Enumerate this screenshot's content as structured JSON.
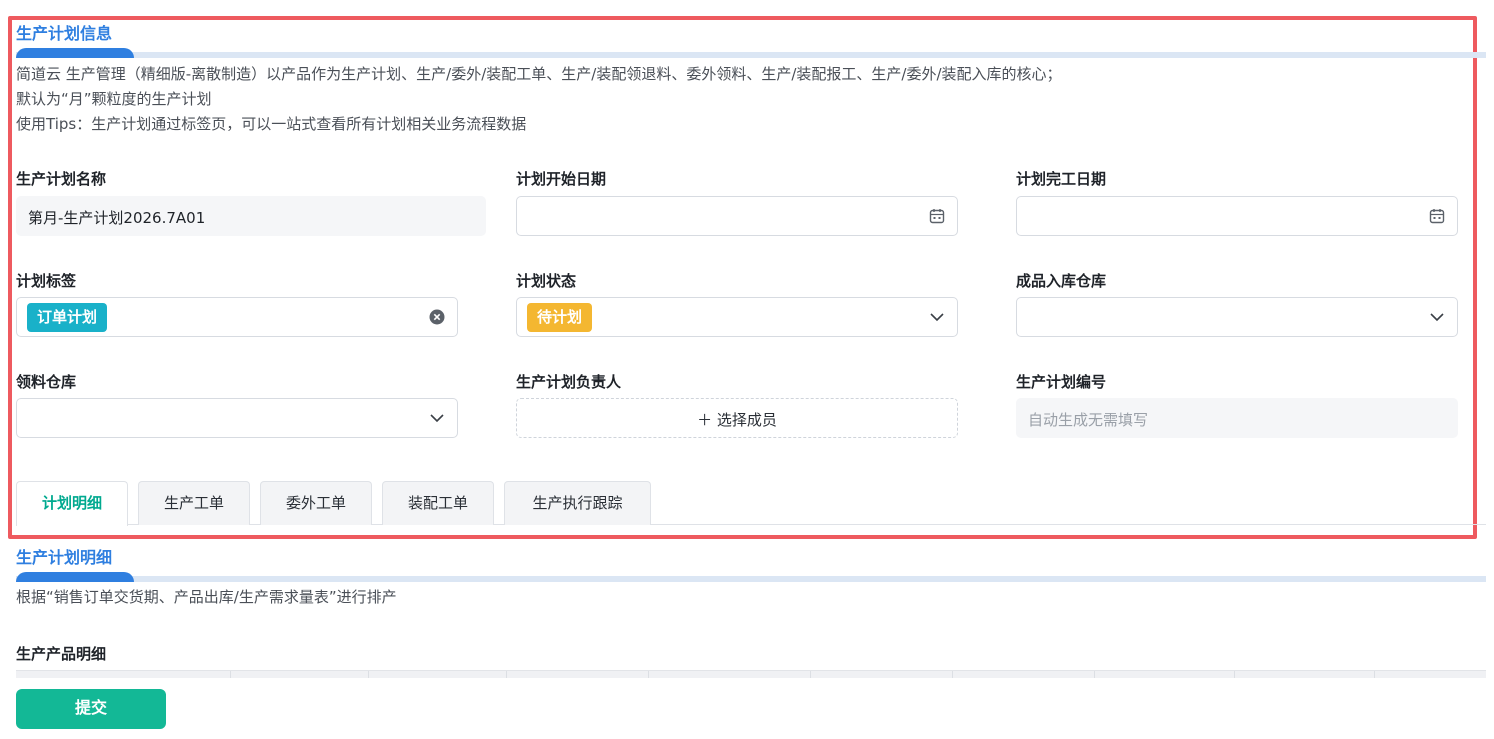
{
  "section1": {
    "title": "生产计划信息",
    "desc_lines": [
      "简道云 生产管理（精细版-离散制造）以产品作为生产计划、生产/委外/装配工单、生产/装配领退料、委外领料、生产/装配报工、生产/委外/装配入库的核心；",
      "默认为“月”颗粒度的生产计划",
      "使用Tips：生产计划通过标签页，可以一站式查看所有计划相关业务流程数据"
    ]
  },
  "fields": {
    "plan_name": {
      "label": "生产计划名称",
      "value": "第月-生产计划2026.7A01"
    },
    "start_date": {
      "label": "计划开始日期",
      "value": ""
    },
    "end_date": {
      "label": "计划完工日期",
      "value": ""
    },
    "plan_tag": {
      "label": "计划标签",
      "tag": "订单计划",
      "tag_color": "#19b1c9"
    },
    "plan_status": {
      "label": "计划状态",
      "tag": "待计划",
      "tag_color": "#f4b731"
    },
    "warehouse_in": {
      "label": "成品入库仓库",
      "value": ""
    },
    "material_warehouse": {
      "label": "领料仓库",
      "value": ""
    },
    "owner": {
      "label": "生产计划负责人",
      "button": "＋ 选择成员"
    },
    "plan_no": {
      "label": "生产计划编号",
      "placeholder": "自动生成无需填写"
    }
  },
  "tabs": [
    {
      "label": "计划明细",
      "active": true
    },
    {
      "label": "生产工单",
      "active": false
    },
    {
      "label": "委外工单",
      "active": false
    },
    {
      "label": "装配工单",
      "active": false
    },
    {
      "label": "生产执行跟踪",
      "active": false
    }
  ],
  "section2": {
    "title": "生产计划明细",
    "desc": "根据“销售订单交货期、产品出库/生产需求量表”进行排产",
    "subtable_label": "生产产品明细"
  },
  "footer": {
    "submit": "提交"
  },
  "colors": {
    "accent": "#2f7fe0",
    "primary": "#13b896",
    "highlight": "#ee5a5f",
    "tab_active": "#00a98f"
  }
}
